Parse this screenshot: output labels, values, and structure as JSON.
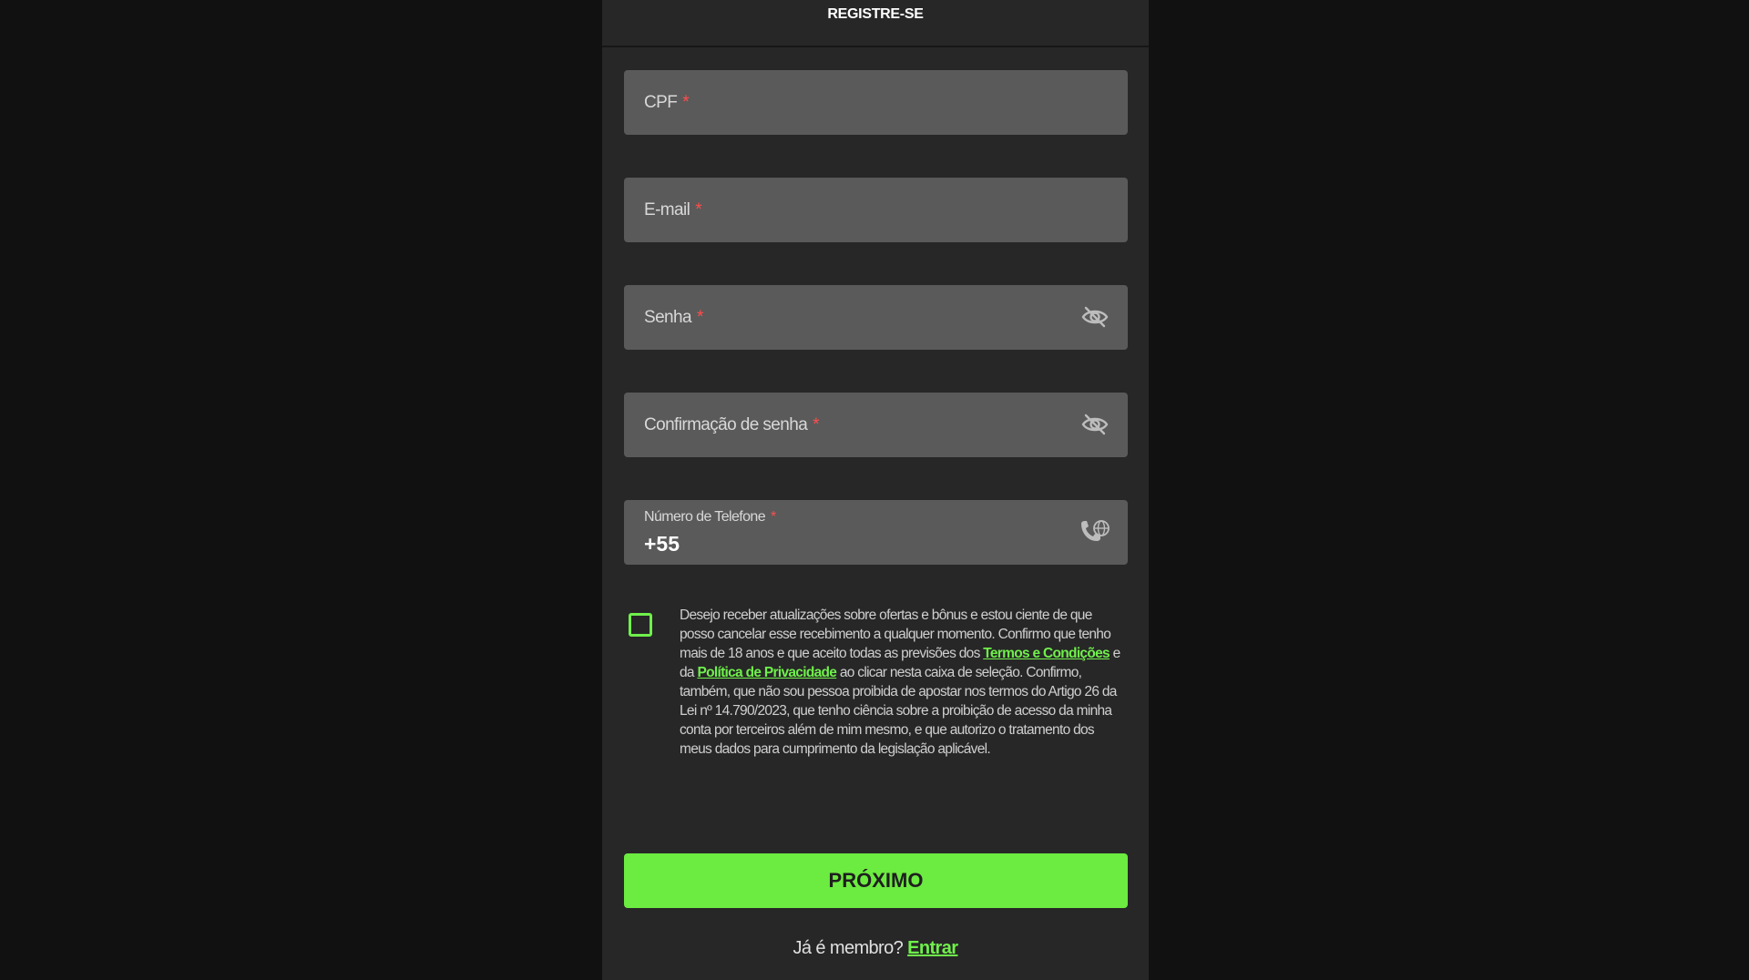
{
  "header": {
    "title": "REGISTRE-SE"
  },
  "fields": {
    "cpf": {
      "label": "CPF",
      "required_mark": "*"
    },
    "email": {
      "label": "E-mail",
      "required_mark": "*"
    },
    "password": {
      "label": "Senha",
      "required_mark": "*",
      "icon": "eye-off-icon"
    },
    "password_confirm": {
      "label": "Confirmação de senha",
      "required_mark": "*",
      "icon": "eye-off-icon"
    },
    "phone": {
      "label": "Número de Telefone",
      "required_mark": "*",
      "value": "+55",
      "icon": "phone-globe-icon"
    }
  },
  "consent": {
    "checked": false,
    "text_1": "Desejo receber atualizações sobre ofertas e bônus e estou ciente de que posso cancelar esse recebimento a qualquer momento. Confirmo que tenho mais de 18 anos e que aceito todas as previsões dos ",
    "terms_link": "Termos e Condições",
    "text_2": " e da ",
    "privacy_link": "Política de Privacidade",
    "text_3": " ao clicar nesta caixa de seleção. Confirmo, também, que não sou pessoa proibida de apostar nos termos do Artigo 26 da Lei nº 14.790/2023, que tenho ciência sobre a proibição de acesso da minha conta por terceiros além de mim mesmo, e que autorizo o tratamento dos meus dados para cumprimento da legislação aplicável."
  },
  "actions": {
    "next_label": "PRÓXIMO"
  },
  "footer": {
    "member_question": "Já é membro?",
    "login_link": "Entrar"
  },
  "colors": {
    "accent": "#6ceb40",
    "background": "#111111",
    "panel": "#272727",
    "field": "#5a5a5a",
    "required": "#ff4d4d"
  }
}
